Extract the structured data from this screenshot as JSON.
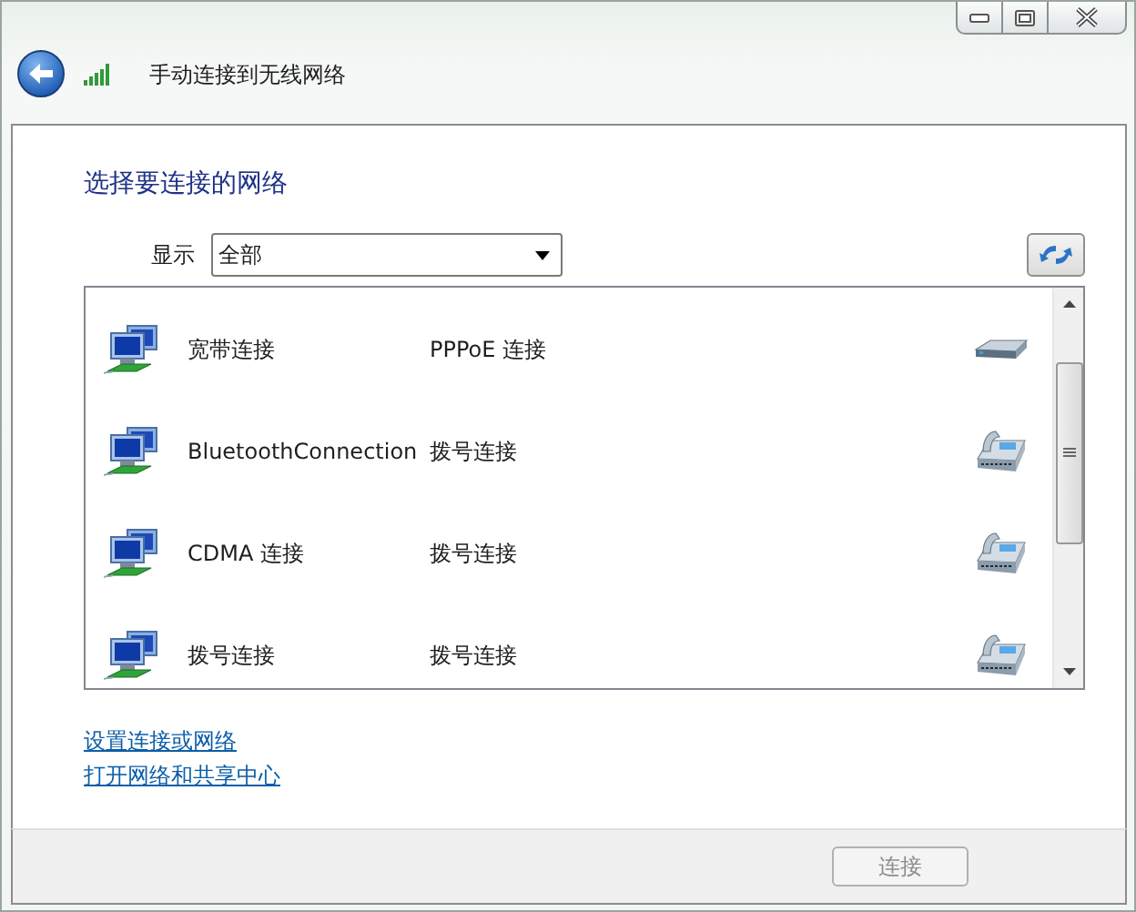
{
  "window": {
    "title": "手动连接到无线网络"
  },
  "heading": "选择要连接的网络",
  "filter": {
    "label": "显示",
    "value": "全部"
  },
  "connections": [
    {
      "name": "宽带连接",
      "type": "PPPoE 连接",
      "kind": "broadband"
    },
    {
      "name": "BluetoothConnection",
      "type": "拨号连接",
      "kind": "dialup"
    },
    {
      "name": "CDMA 连接",
      "type": "拨号连接",
      "kind": "dialup"
    },
    {
      "name": "拨号连接",
      "type": "拨号连接",
      "kind": "dialup"
    }
  ],
  "links": [
    "设置连接或网络",
    "打开网络和共享中心"
  ],
  "buttons": [
    {
      "label": "连接",
      "disabled": true
    }
  ]
}
